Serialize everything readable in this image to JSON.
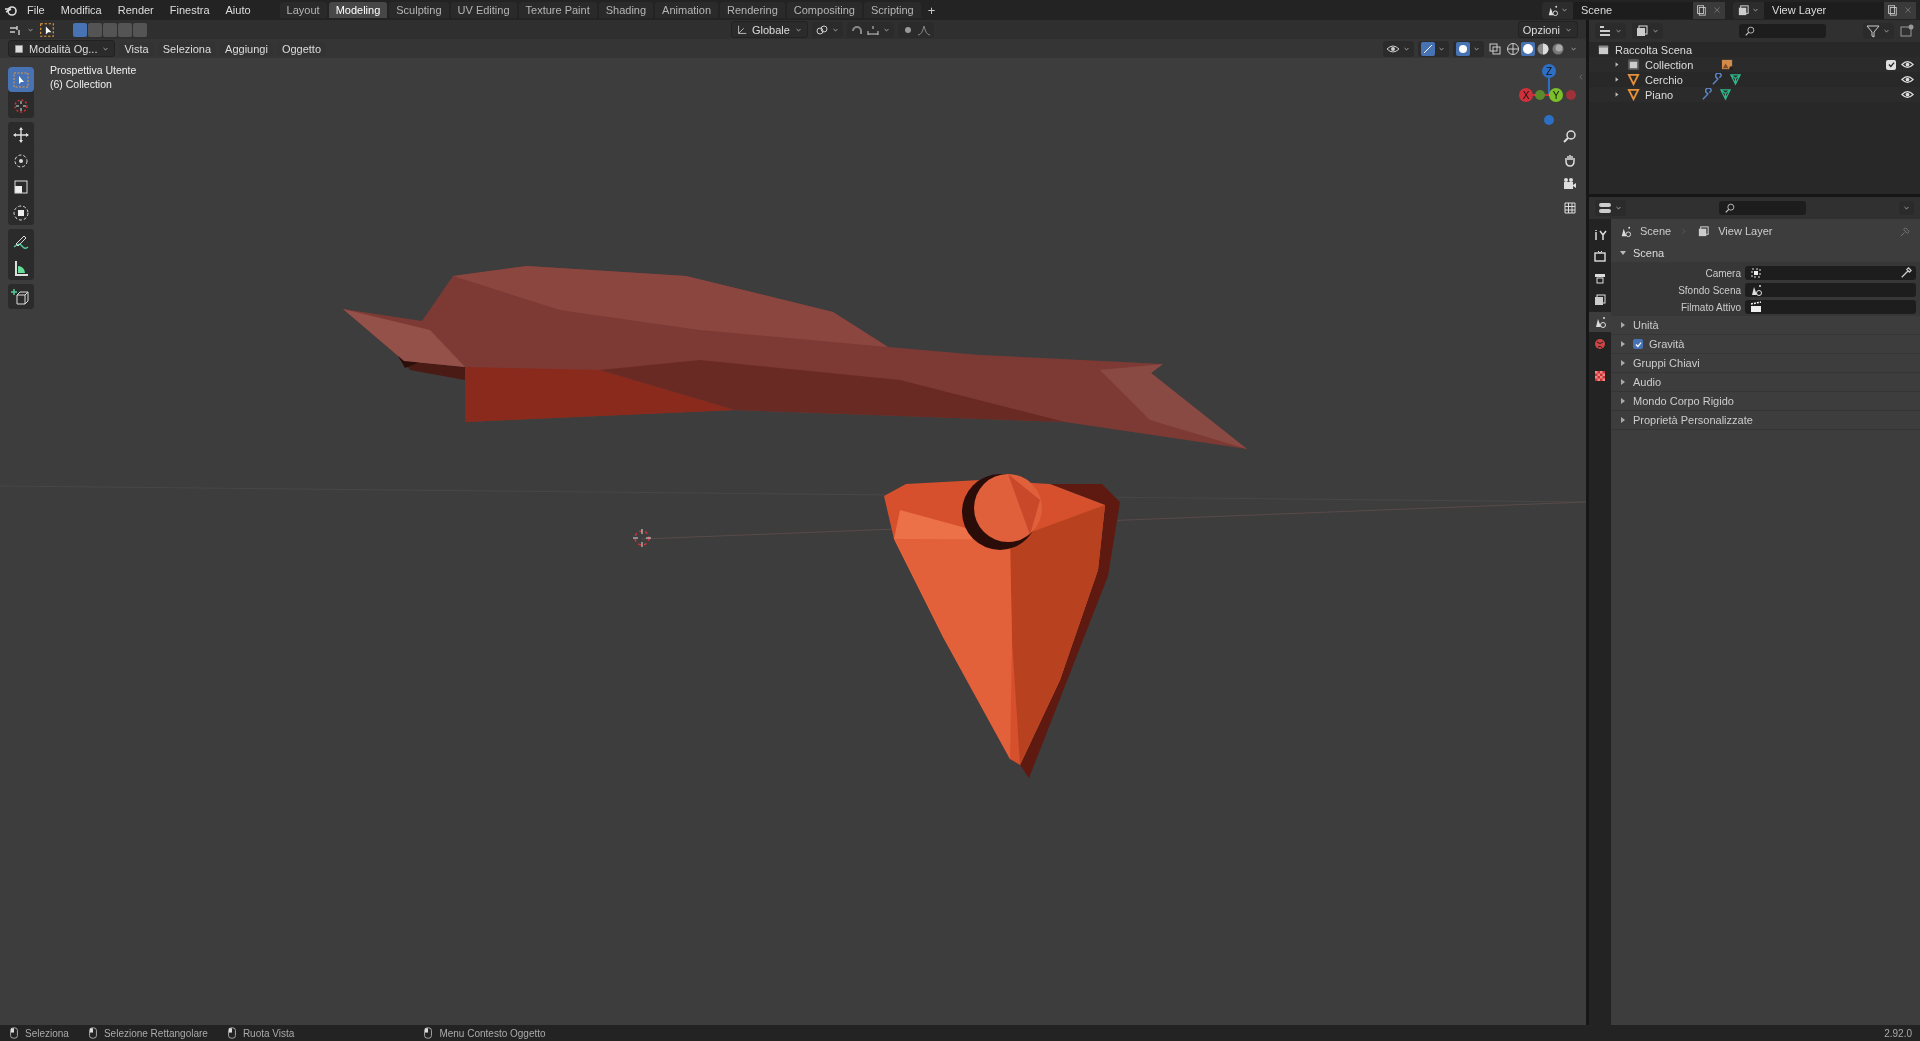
{
  "top_bar": {
    "menus": [
      "File",
      "Modifica",
      "Render",
      "Finestra",
      "Aiuto"
    ],
    "workspaces": [
      {
        "label": "Layout",
        "selected": false
      },
      {
        "label": "Modeling",
        "selected": true
      },
      {
        "label": "Sculpting",
        "selected": false
      },
      {
        "label": "UV Editing",
        "selected": false
      },
      {
        "label": "Texture Paint",
        "selected": false
      },
      {
        "label": "Shading",
        "selected": false
      },
      {
        "label": "Animation",
        "selected": false
      },
      {
        "label": "Rendering",
        "selected": false
      },
      {
        "label": "Compositing",
        "selected": false
      },
      {
        "label": "Scripting",
        "selected": false
      }
    ],
    "add_tab": "+",
    "scene": "Scene",
    "view_layer": "View Layer"
  },
  "tool_header": {
    "transform_orientation": "Globale",
    "options": "Opzioni"
  },
  "view_header": {
    "mode": "Modalità Og...",
    "menus": [
      "Vista",
      "Seleziona",
      "Aggiungi",
      "Oggetto"
    ]
  },
  "toolbar": {
    "tools": [
      {
        "kind": "select",
        "selected": true
      },
      {
        "kind": "cursor",
        "selected": false
      },
      {
        "kind": "move",
        "selected": false
      },
      {
        "kind": "rotate",
        "selected": false
      },
      {
        "kind": "scale",
        "selected": false
      },
      {
        "kind": "transform",
        "selected": false
      },
      {
        "kind": "annotate",
        "selected": false
      },
      {
        "kind": "measure",
        "selected": false
      },
      {
        "kind": "add_cube",
        "selected": false
      }
    ]
  },
  "viewport": {
    "view_name": "Prospettiva Utente",
    "collection_label": "(6) Collection",
    "gizmo_axes": [
      {
        "kind": "z",
        "label": "Z"
      },
      {
        "kind": "y",
        "label": "Y"
      },
      {
        "kind": "x",
        "label": "X"
      }
    ]
  },
  "outliner": {
    "root": "Raccolta Scena",
    "items": [
      {
        "name": "Collection",
        "kind": "collection",
        "checked": true
      },
      {
        "name": "Cerchio",
        "kind": "mesh"
      },
      {
        "name": "Piano",
        "kind": "mesh"
      }
    ]
  },
  "properties": {
    "breadcrumb": [
      "Scene",
      "View Layer"
    ],
    "tabs": [
      {
        "kind": "tool",
        "selected": false
      },
      {
        "kind": "render",
        "selected": false
      },
      {
        "kind": "output",
        "selected": false
      },
      {
        "kind": "view_layer",
        "selected": false
      },
      {
        "kind": "scene",
        "selected": true
      },
      {
        "kind": "world",
        "selected": false
      },
      {
        "kind": "texture",
        "selected": false
      }
    ],
    "panel": {
      "title": "Scena",
      "expanded": true,
      "fields": [
        {
          "label": "Camera",
          "kind": "camera"
        },
        {
          "label": "Sfondo Scena",
          "kind": "scene"
        },
        {
          "label": "Filmato Attivo",
          "kind": "clip"
        }
      ]
    },
    "subpanels": [
      {
        "title": "Unità",
        "expanded": false,
        "kind": "plain"
      },
      {
        "title": "Gravità",
        "expanded": false,
        "kind": "checkbox",
        "checked": true
      },
      {
        "title": "Gruppi Chiavi",
        "expanded": false,
        "kind": "plain"
      },
      {
        "title": "Audio",
        "expanded": false,
        "kind": "plain"
      },
      {
        "title": "Mondo Corpo Rigido",
        "expanded": false,
        "kind": "plain"
      },
      {
        "title": "Proprietà Personalizzate",
        "expanded": false,
        "kind": "plain"
      }
    ]
  },
  "status_bar": {
    "hints": [
      "Seleziona",
      "Selezione Rettangolare",
      "Ruota Vista",
      "Menu Contesto Oggetto"
    ],
    "version": "2.92.0"
  }
}
